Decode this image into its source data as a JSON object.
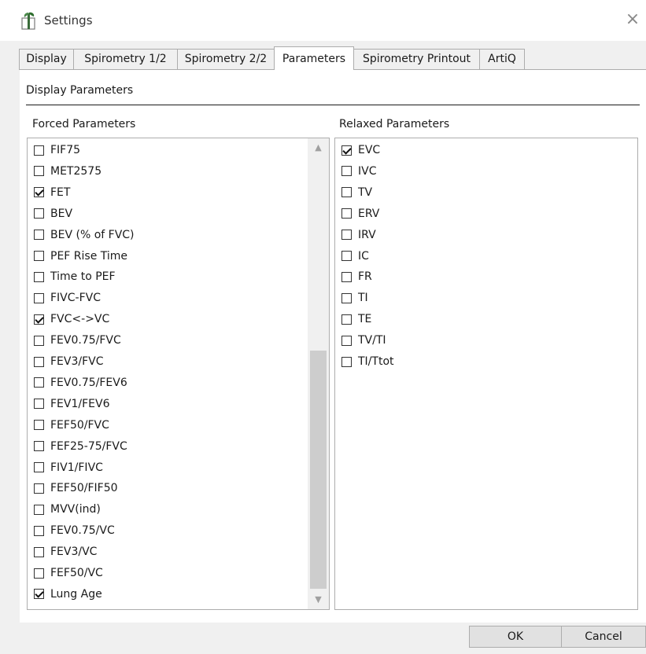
{
  "window": {
    "title": "Settings",
    "close_glyph": "×"
  },
  "tabs": [
    {
      "label": "Display"
    },
    {
      "label": "Spirometry 1/2"
    },
    {
      "label": "Spirometry 2/2"
    },
    {
      "label": "Parameters",
      "active": true
    },
    {
      "label": "Spirometry Printout"
    },
    {
      "label": "ArtiQ"
    }
  ],
  "section": {
    "label": "Display Parameters"
  },
  "forced": {
    "label": "Forced Parameters",
    "items": [
      {
        "label": "FIF75",
        "checked": false
      },
      {
        "label": "MET2575",
        "checked": false
      },
      {
        "label": "FET",
        "checked": true
      },
      {
        "label": "BEV",
        "checked": false
      },
      {
        "label": "BEV (% of FVC)",
        "checked": false
      },
      {
        "label": "PEF Rise Time",
        "checked": false
      },
      {
        "label": "Time to PEF",
        "checked": false
      },
      {
        "label": "FIVC-FVC",
        "checked": false
      },
      {
        "label": "FVC<->VC",
        "checked": true
      },
      {
        "label": "FEV0.75/FVC",
        "checked": false
      },
      {
        "label": "FEV3/FVC",
        "checked": false
      },
      {
        "label": "FEV0.75/FEV6",
        "checked": false
      },
      {
        "label": "FEV1/FEV6",
        "checked": false
      },
      {
        "label": "FEF50/FVC",
        "checked": false
      },
      {
        "label": "FEF25-75/FVC",
        "checked": false
      },
      {
        "label": "FIV1/FIVC",
        "checked": false
      },
      {
        "label": "FEF50/FIF50",
        "checked": false
      },
      {
        "label": "MVV(ind)",
        "checked": false
      },
      {
        "label": "FEV0.75/VC",
        "checked": false
      },
      {
        "label": "FEV3/VC",
        "checked": false
      },
      {
        "label": "FEF50/VC",
        "checked": false
      },
      {
        "label": "Lung Age",
        "checked": true
      }
    ]
  },
  "relaxed": {
    "label": "Relaxed Parameters",
    "items": [
      {
        "label": "EVC",
        "checked": true
      },
      {
        "label": "IVC",
        "checked": false
      },
      {
        "label": "TV",
        "checked": false
      },
      {
        "label": "ERV",
        "checked": false
      },
      {
        "label": "IRV",
        "checked": false
      },
      {
        "label": "IC",
        "checked": false
      },
      {
        "label": "FR",
        "checked": false
      },
      {
        "label": "TI",
        "checked": false
      },
      {
        "label": "TE",
        "checked": false
      },
      {
        "label": "TV/TI",
        "checked": false
      },
      {
        "label": "TI/Ttot",
        "checked": false
      }
    ]
  },
  "buttons": {
    "ok": "OK",
    "cancel": "Cancel"
  },
  "icons": {
    "app": "settings-app-icon",
    "close": "close-icon",
    "scroll_up": "scroll-up-arrow-icon",
    "scroll_down": "scroll-down-arrow-icon",
    "check": "checkmark-icon"
  }
}
